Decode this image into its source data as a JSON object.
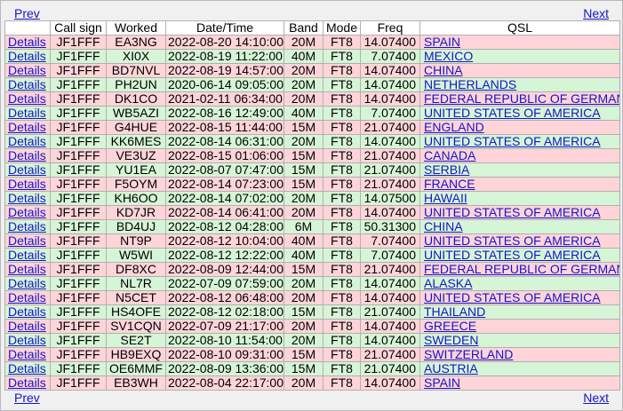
{
  "nav": {
    "prev_label": "Prev",
    "next_label": "Next"
  },
  "columns": [
    "",
    "Call sign",
    "Worked",
    "Date/Time",
    "Band",
    "Mode",
    "Freq",
    "QSL"
  ],
  "details_label": "Details",
  "row_colors": {
    "odd": "#ffd4d9",
    "even": "#d6f5d6",
    "link": "#1515c8"
  },
  "rows": [
    {
      "call": "JF1FFF",
      "worked": "EA3NG",
      "datetime": "2022-08-20 14:10:00",
      "band": "20M",
      "mode": "FT8",
      "freq": "14.07400",
      "qsl": "SPAIN"
    },
    {
      "call": "JF1FFF",
      "worked": "XI0X",
      "datetime": "2022-08-19 11:22:00",
      "band": "40M",
      "mode": "FT8",
      "freq": "7.07400",
      "qsl": "MEXICO"
    },
    {
      "call": "JF1FFF",
      "worked": "BD7NVL",
      "datetime": "2022-08-19 14:57:00",
      "band": "20M",
      "mode": "FT8",
      "freq": "14.07400",
      "qsl": "CHINA"
    },
    {
      "call": "JF1FFF",
      "worked": "PH2UN",
      "datetime": "2020-06-14 09:05:00",
      "band": "20M",
      "mode": "FT8",
      "freq": "14.07400",
      "qsl": "NETHERLANDS"
    },
    {
      "call": "JF1FFF",
      "worked": "DK1CO",
      "datetime": "2021-02-11 06:34:00",
      "band": "20M",
      "mode": "FT8",
      "freq": "14.07400",
      "qsl": "FEDERAL REPUBLIC OF GERMANY"
    },
    {
      "call": "JF1FFF",
      "worked": "WB5AZI",
      "datetime": "2022-08-16 12:49:00",
      "band": "40M",
      "mode": "FT8",
      "freq": "7.07400",
      "qsl": "UNITED STATES OF AMERICA"
    },
    {
      "call": "JF1FFF",
      "worked": "G4HUE",
      "datetime": "2022-08-15 11:44:00",
      "band": "15M",
      "mode": "FT8",
      "freq": "21.07400",
      "qsl": "ENGLAND"
    },
    {
      "call": "JF1FFF",
      "worked": "KK6MES",
      "datetime": "2022-08-14 06:31:00",
      "band": "20M",
      "mode": "FT8",
      "freq": "14.07400",
      "qsl": "UNITED STATES OF AMERICA"
    },
    {
      "call": "JF1FFF",
      "worked": "VE3UZ",
      "datetime": "2022-08-15 01:06:00",
      "band": "15M",
      "mode": "FT8",
      "freq": "21.07400",
      "qsl": "CANADA"
    },
    {
      "call": "JF1FFF",
      "worked": "YU1EA",
      "datetime": "2022-08-07 07:47:00",
      "band": "15M",
      "mode": "FT8",
      "freq": "21.07400",
      "qsl": "SERBIA"
    },
    {
      "call": "JF1FFF",
      "worked": "F5OYM",
      "datetime": "2022-08-14 07:23:00",
      "band": "15M",
      "mode": "FT8",
      "freq": "21.07400",
      "qsl": "FRANCE"
    },
    {
      "call": "JF1FFF",
      "worked": "KH6OO",
      "datetime": "2022-08-14 07:02:00",
      "band": "20M",
      "mode": "FT8",
      "freq": "14.07500",
      "qsl": "HAWAII"
    },
    {
      "call": "JF1FFF",
      "worked": "KD7JR",
      "datetime": "2022-08-14 06:41:00",
      "band": "20M",
      "mode": "FT8",
      "freq": "14.07400",
      "qsl": "UNITED STATES OF AMERICA"
    },
    {
      "call": "JF1FFF",
      "worked": "BD4UJ",
      "datetime": "2022-08-12 04:28:00",
      "band": "6M",
      "mode": "FT8",
      "freq": "50.31300",
      "qsl": "CHINA"
    },
    {
      "call": "JF1FFF",
      "worked": "NT9P",
      "datetime": "2022-08-12 10:04:00",
      "band": "40M",
      "mode": "FT8",
      "freq": "7.07400",
      "qsl": "UNITED STATES OF AMERICA"
    },
    {
      "call": "JF1FFF",
      "worked": "W5WI",
      "datetime": "2022-08-12 12:22:00",
      "band": "40M",
      "mode": "FT8",
      "freq": "7.07400",
      "qsl": "UNITED STATES OF AMERICA"
    },
    {
      "call": "JF1FFF",
      "worked": "DF8XC",
      "datetime": "2022-08-09 12:44:00",
      "band": "15M",
      "mode": "FT8",
      "freq": "21.07400",
      "qsl": "FEDERAL REPUBLIC OF GERMANY"
    },
    {
      "call": "JF1FFF",
      "worked": "NL7R",
      "datetime": "2022-07-09 07:59:00",
      "band": "20M",
      "mode": "FT8",
      "freq": "14.07400",
      "qsl": "ALASKA"
    },
    {
      "call": "JF1FFF",
      "worked": "N5CET",
      "datetime": "2022-08-12 06:48:00",
      "band": "20M",
      "mode": "FT8",
      "freq": "14.07400",
      "qsl": "UNITED STATES OF AMERICA"
    },
    {
      "call": "JF1FFF",
      "worked": "HS4OFE",
      "datetime": "2022-08-12 02:18:00",
      "band": "15M",
      "mode": "FT8",
      "freq": "21.07400",
      "qsl": "THAILAND"
    },
    {
      "call": "JF1FFF",
      "worked": "SV1CQN",
      "datetime": "2022-07-09 21:17:00",
      "band": "20M",
      "mode": "FT8",
      "freq": "14.07400",
      "qsl": "GREECE"
    },
    {
      "call": "JF1FFF",
      "worked": "SE2T",
      "datetime": "2022-08-10 11:54:00",
      "band": "20M",
      "mode": "FT8",
      "freq": "14.07400",
      "qsl": "SWEDEN"
    },
    {
      "call": "JF1FFF",
      "worked": "HB9EXQ",
      "datetime": "2022-08-10 09:31:00",
      "band": "15M",
      "mode": "FT8",
      "freq": "21.07400",
      "qsl": "SWITZERLAND"
    },
    {
      "call": "JF1FFF",
      "worked": "OE6MMF",
      "datetime": "2022-08-09 13:36:00",
      "band": "15M",
      "mode": "FT8",
      "freq": "21.07400",
      "qsl": "AUSTRIA"
    },
    {
      "call": "JF1FFF",
      "worked": "EB3WH",
      "datetime": "2022-08-04 22:17:00",
      "band": "20M",
      "mode": "FT8",
      "freq": "14.07400",
      "qsl": "SPAIN"
    }
  ]
}
